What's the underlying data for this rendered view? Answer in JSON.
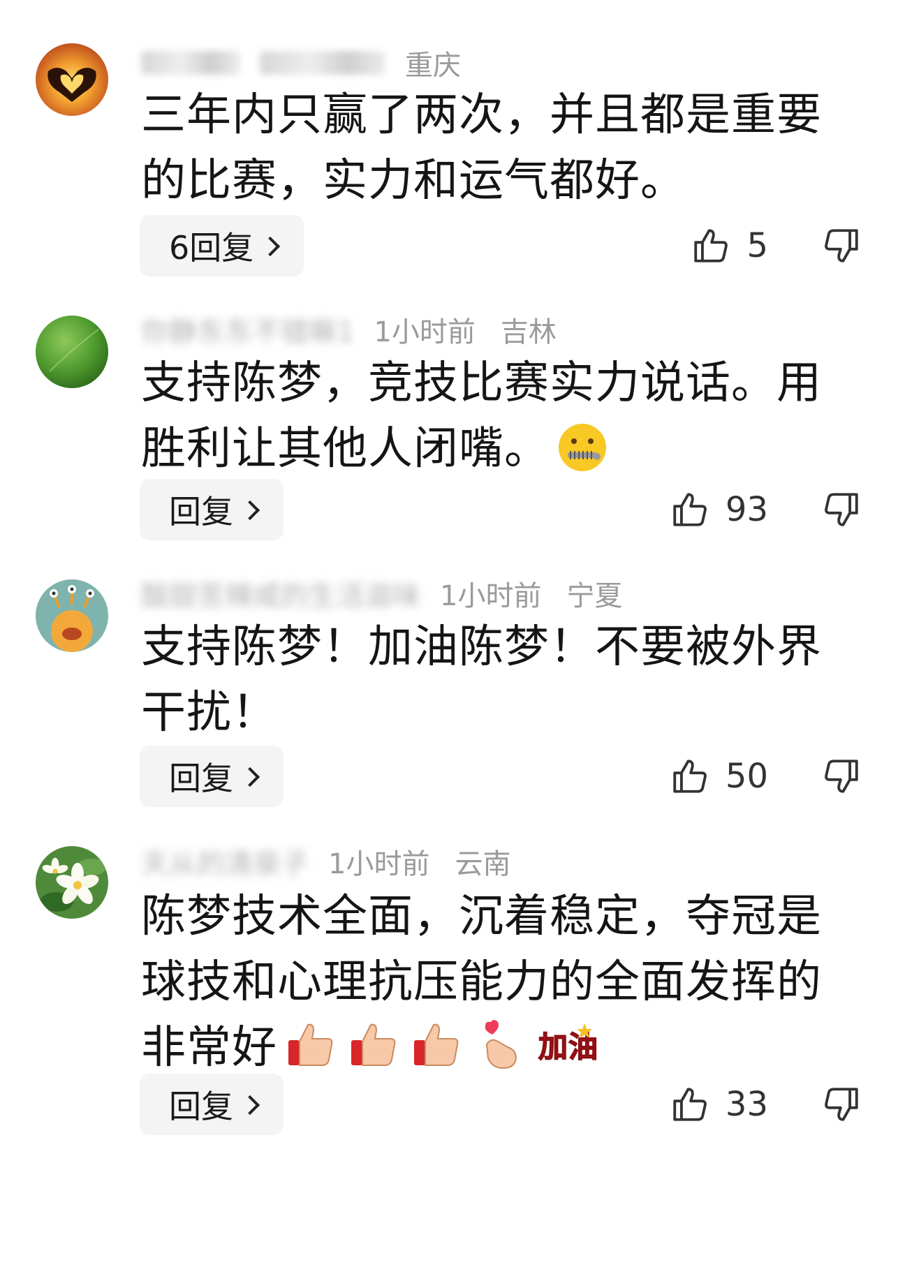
{
  "comments": [
    {
      "username": "寻  里  清  荣  重",
      "time": "",
      "location": "重庆",
      "text_lines": [
        "三年内只赢了两次，并且都是重要",
        "的比赛，实力和运气都好。"
      ],
      "reply_label": "6回复",
      "likes": "5",
      "avatar_icon": "heart-hands-sunset-icon"
    },
    {
      "username": "你静东东不错嘛1",
      "time": "1小时前",
      "location": "吉林",
      "text_lines": [
        "支持陈梦，竞技比赛实力说话。用",
        "胜利让其他人闭嘴。"
      ],
      "reply_label": "回复",
      "likes": "93",
      "avatar_icon": "green-leaf-icon",
      "trailing_emoji": "zipper-mouth-face-icon"
    },
    {
      "username": "酸甜苦辣咸的生活滋味",
      "time": "1小时前",
      "location": "宁夏",
      "text_lines": [
        "支持陈梦！加油陈梦！不要被外界",
        "干扰！"
      ],
      "reply_label": "回复",
      "likes": "50",
      "avatar_icon": "orange-monster-icon"
    },
    {
      "username": "天从的清泉子",
      "time": "1小时前",
      "location": "云南",
      "text_lines": [
        "陈梦技术全面，沉着稳定，夺冠是",
        "球技和心理抗压能力的全面发挥的",
        "非常好"
      ],
      "reply_label": "回复",
      "likes": "33",
      "avatar_icon": "white-flower-icon",
      "trailing_emojis": [
        "thumbs-up-icon",
        "thumbs-up-icon",
        "thumbs-up-icon",
        "finger-heart-icon",
        "jiayou-sticker-icon"
      ],
      "sticker_text": "加油"
    }
  ]
}
